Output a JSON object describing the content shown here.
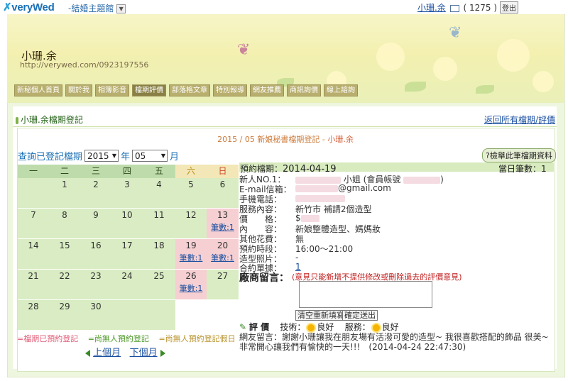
{
  "topbar": {
    "logo": "veryWed",
    "theme_label": "-結婚主題館",
    "user_name": "小珊.余",
    "mail_count": "( 1275 )",
    "logout_label": "登出"
  },
  "banner": {
    "blog_name": "小珊.余",
    "blog_url": "http://verywed.com/0923197556"
  },
  "menu": [
    {
      "label": "新秘個人首頁"
    },
    {
      "label": "關於我"
    },
    {
      "label": "相簿影音"
    },
    {
      "label": "檔期評價"
    },
    {
      "label": "部落格文章"
    },
    {
      "label": "特別報導"
    },
    {
      "label": "網友推薦"
    },
    {
      "label": "商訊詢價"
    },
    {
      "label": "線上諮詢"
    }
  ],
  "section": {
    "title": "小珊.余檔期登記",
    "back_link": "返回所有檔期/評價"
  },
  "period": {
    "title_prefix": "2015 / 05 新娘秘書檔期登記 - ",
    "title_name": "小珊.余"
  },
  "query": {
    "label": "查詢已登記檔期",
    "year": "2015",
    "year_unit": "年",
    "month": "05",
    "month_unit": "月"
  },
  "calendar": {
    "weekdays": [
      "一",
      "二",
      "三",
      "四",
      "五",
      "六",
      "日"
    ],
    "rows": [
      [
        "",
        "1",
        "2",
        "3",
        "4",
        "5",
        "6"
      ],
      [
        "7",
        "8",
        "9",
        "10",
        "11",
        "12",
        "13"
      ],
      [
        "14",
        "15",
        "16",
        "17",
        "18",
        "19",
        "20"
      ],
      [
        "21",
        "22",
        "23",
        "24",
        "25",
        "26",
        "27"
      ],
      [
        "28",
        "29",
        "30",
        "",
        "",
        "",
        ""
      ]
    ],
    "booked_label": "筆數:1"
  },
  "legend": {
    "booked": "=檔期已預約登記",
    "free": "=尚無人預約登記",
    "free_holiday": "=尚無人預約登記假日"
  },
  "month_nav": {
    "prev": "上個月",
    "next": "下個月"
  },
  "detail": {
    "button": "?檢舉此筆檔期資料",
    "date_label": "預約檔期：",
    "date": "2014-04-19",
    "count_label": "當日筆數：",
    "count": "1",
    "fields": [
      {
        "label": "新人NO.1：",
        "value": "小姐 (會員帳號"
      },
      {
        "label": "E-mail信箱：",
        "value": "@gmail.com"
      },
      {
        "label": "手機電話：",
        "value": ""
      },
      {
        "label": "服務內容：",
        "value": "新竹市 補請2個造型"
      },
      {
        "label": "價　　格：",
        "value": "$"
      },
      {
        "label": "內　　容：",
        "value": "新娘整體造型、媽媽妝"
      },
      {
        "label": "其他花費：",
        "value": "無"
      },
      {
        "label": "預約時段：",
        "value": "16:00～21:00"
      },
      {
        "label": "造型照片：",
        "value": "-"
      },
      {
        "label": "合約單據：",
        "value": "1"
      }
    ],
    "message_title": "廠商留言：",
    "message_note": "(意見只能新增不提供修改或刪除過去的評價意見)",
    "clear_button": "清空重新填寫",
    "send_button": "確定送出",
    "eval_title": "評 價",
    "tech_label": "技術：",
    "tech_value": "良好",
    "service_label": "服務：",
    "service_value": "良好",
    "review": "網友留言：謝謝小珊讓我在朋友場有活潑可愛的造型~ 我很喜歡搭配的飾品 很美~ 非常開心讓我們有愉快的一天!!!　(2014-04-24 22:47:30)"
  },
  "colors": {
    "booked": "#f6cfd2",
    "free": "#d9ecc3",
    "weekend_head": "#f3e7b7",
    "weekday_head": "#bedcab"
  }
}
